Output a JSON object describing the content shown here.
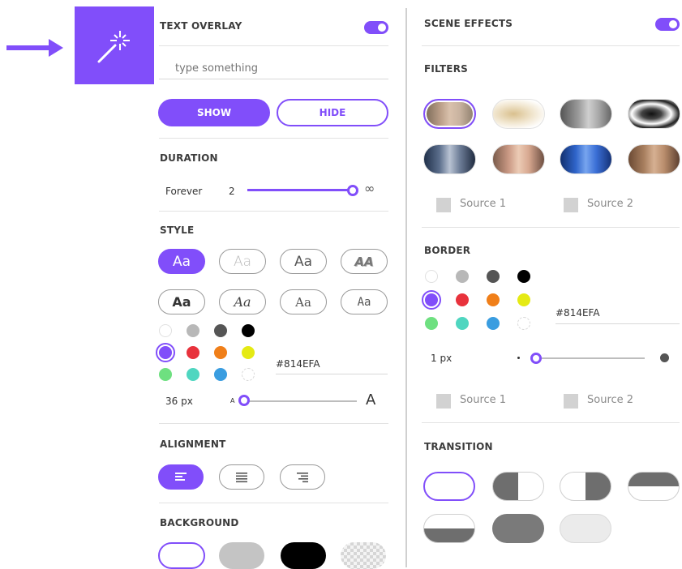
{
  "text_overlay": {
    "title": "TEXT OVERLAY",
    "toggle_on": true,
    "input_placeholder": "type something",
    "show_label": "SHOW",
    "hide_label": "HIDE"
  },
  "duration": {
    "title": "DURATION",
    "label": "Forever",
    "value": "2",
    "max_symbol": "∞",
    "slider_fraction": 1.0
  },
  "style": {
    "title": "STYLE",
    "font_samples": [
      "Aa",
      "Aa",
      "Aa",
      "AA",
      "Aa",
      "Aa",
      "Aa",
      "Aa"
    ],
    "selected_index": 0,
    "colors": [
      "#ffffff",
      "#b8b8b8",
      "#555555",
      "#000000",
      "#814EFA",
      "#e8323c",
      "#f07f19",
      "#e5ea14",
      "#6ee080",
      "#4fd6c0",
      "#3a9de0",
      "#ffffff"
    ],
    "selected_color_index": 4,
    "hex_value": "#814EFA",
    "size_label": "36 px",
    "size_min_symbol": "A",
    "size_max_symbol": "A",
    "size_slider_fraction": 0.0
  },
  "alignment": {
    "title": "ALIGNMENT",
    "options": [
      "left",
      "center",
      "right"
    ],
    "selected": "left"
  },
  "background": {
    "title": "BACKGROUND",
    "options": [
      "white",
      "gray",
      "black",
      "transparent"
    ],
    "selected": "white"
  },
  "scene_effects": {
    "title": "SCENE EFFECTS",
    "toggle_on": true
  },
  "filters": {
    "title": "FILTERS",
    "items": [
      "original",
      "vintage",
      "grayscale",
      "high-contrast",
      "dark-blue",
      "warm",
      "blue",
      "sepia"
    ],
    "selected_index": 0,
    "source1": "Source 1",
    "source2": "Source 2"
  },
  "border": {
    "title": "BORDER",
    "colors": [
      "#ffffff",
      "#b8b8b8",
      "#555555",
      "#000000",
      "#814EFA",
      "#e8323c",
      "#f07f19",
      "#e5ea14",
      "#6ee080",
      "#4fd6c0",
      "#3a9de0",
      "#ffffff"
    ],
    "selected_color_index": 4,
    "hex_value": "#814EFA",
    "width_label": "1 px",
    "width_slider_fraction": 0.0,
    "source1": "Source 1",
    "source2": "Source 2"
  },
  "transition": {
    "title": "TRANSITION",
    "items": [
      "none",
      "wipe-right",
      "wipe-left",
      "wipe-down",
      "wipe-up",
      "fade-dark",
      "fade-light"
    ],
    "selected_index": 0
  },
  "accent_color": "#814EFA",
  "icons": {
    "pointer": "arrow-right-icon",
    "tool": "magic-wand-icon"
  }
}
